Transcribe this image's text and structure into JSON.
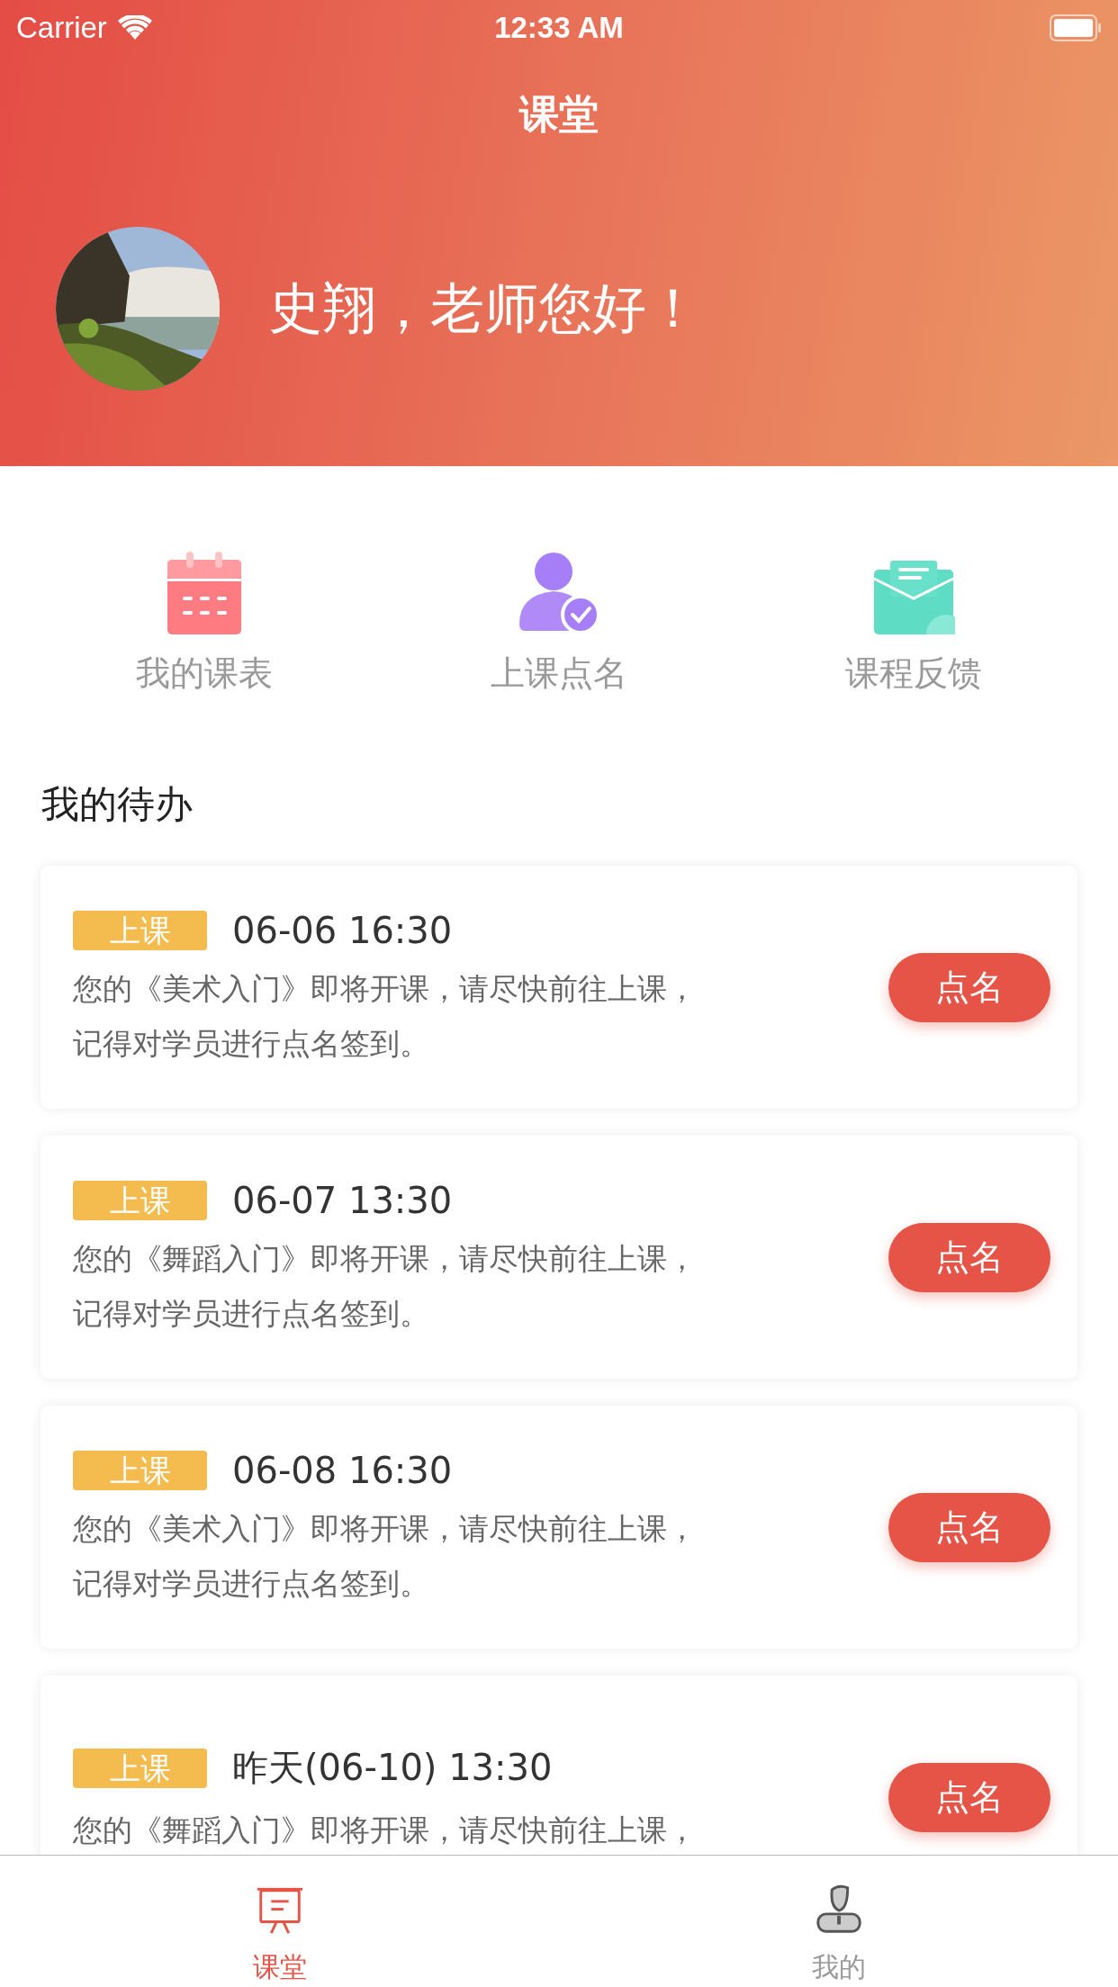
{
  "status_bar": {
    "carrier": "Carrier",
    "time": "12:33 AM"
  },
  "nav": {
    "title": "课堂"
  },
  "profile": {
    "greeting": "史翔，老师您好！"
  },
  "shortcuts": [
    {
      "kind": "calendar",
      "label": "我的课表"
    },
    {
      "kind": "roll-call",
      "label": "上课点名"
    },
    {
      "kind": "feedback",
      "label": "课程反馈"
    }
  ],
  "todo_section": {
    "title": "我的待办"
  },
  "todos": [
    {
      "tag": "上课",
      "time": "06-06 16:30",
      "message_lines": [
        "您的《美术入门》即将开课，请尽快前往上课，",
        "记得对学员进行点名签到。"
      ],
      "button": "点名"
    },
    {
      "tag": "上课",
      "time": "06-07 13:30",
      "message_lines": [
        "您的《舞蹈入门》即将开课，请尽快前往上课，",
        "记得对学员进行点名签到。"
      ],
      "button": "点名"
    },
    {
      "tag": "上课",
      "time": "06-08 16:30",
      "message_lines": [
        "您的《美术入门》即将开课，请尽快前往上课，",
        "记得对学员进行点名签到。"
      ],
      "button": "点名"
    },
    {
      "tag": "上课",
      "time": "昨天(06-10) 13:30",
      "message_lines": [
        "您的《舞蹈入门》即将开课，请尽快前往上课，"
      ],
      "button": "点名"
    }
  ],
  "tab_bar": [
    {
      "kind": "classroom",
      "label": "课堂",
      "selected": true
    },
    {
      "kind": "profile",
      "label": "我的",
      "selected": false
    }
  ]
}
